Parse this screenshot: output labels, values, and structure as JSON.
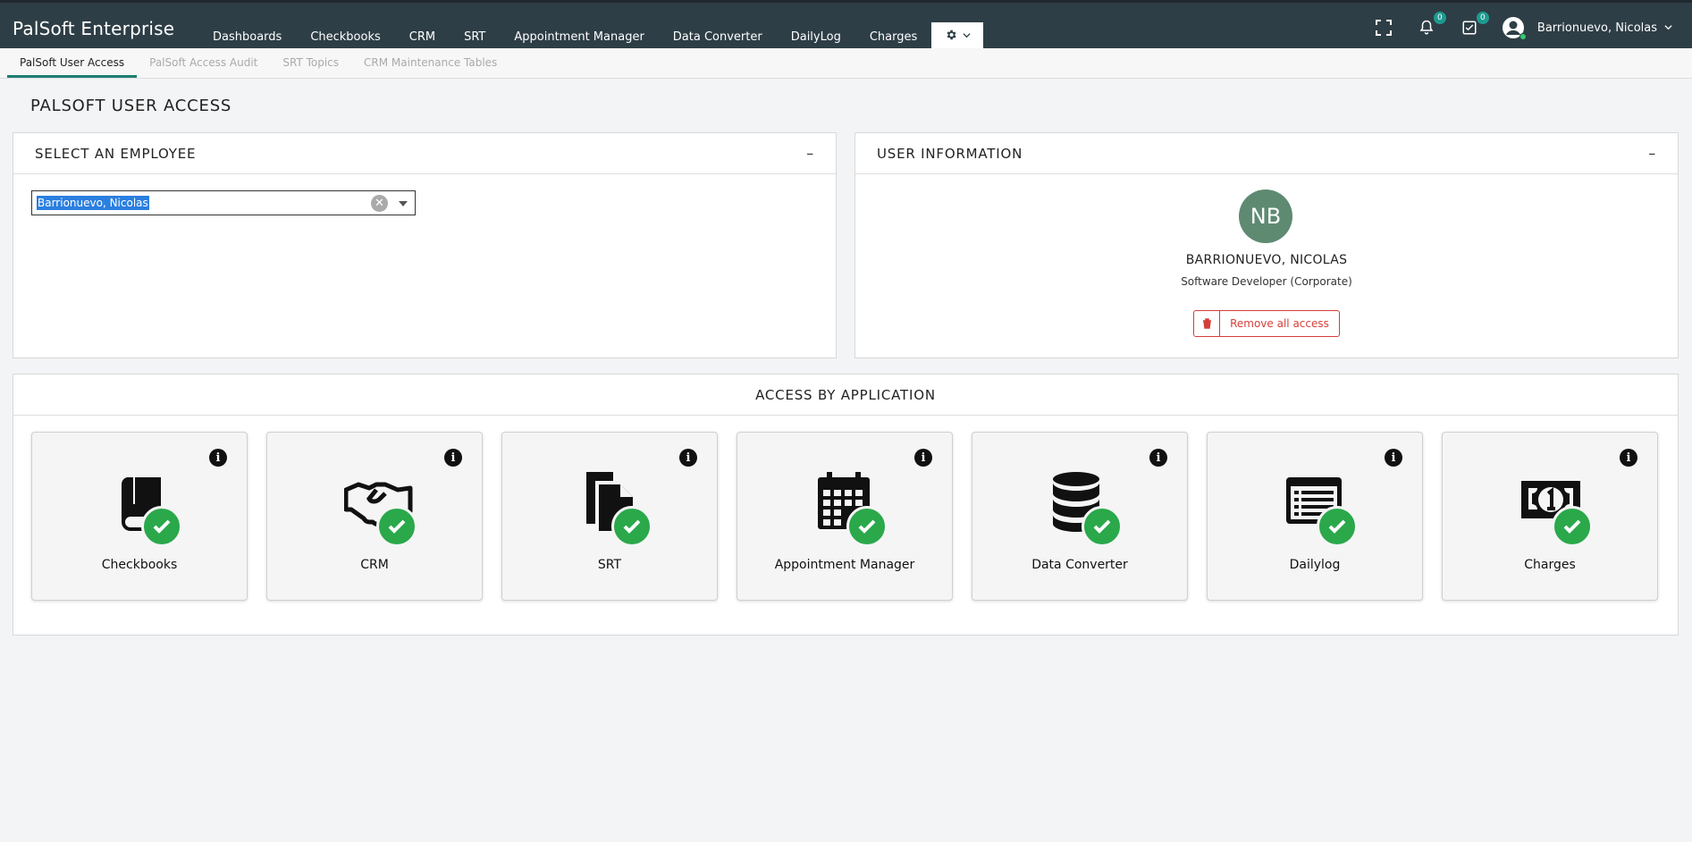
{
  "app": {
    "title": "PalSoft Enterprise"
  },
  "nav": {
    "items": [
      "Dashboards",
      "Checkbooks",
      "CRM",
      "SRT",
      "Appointment Manager",
      "Data Converter",
      "DailyLog",
      "Charges"
    ]
  },
  "topbar": {
    "notifications_count": "0",
    "tasks_count": "0",
    "user_name": "Barrionuevo, Nicolas"
  },
  "subtabs": [
    "PalSoft User Access",
    "PalSoft Access Audit",
    "SRT Topics",
    "CRM Maintenance Tables"
  ],
  "page": {
    "title": "PALSOFT USER ACCESS"
  },
  "employee_panel": {
    "title": "SELECT AN EMPLOYEE",
    "collapse": "–",
    "selected": "Barrionuevo, Nicolas"
  },
  "user_panel": {
    "title": "USER INFORMATION",
    "collapse": "–",
    "initials": "NB",
    "name": "BARRIONUEVO, NICOLAS",
    "role": "Software Developer (Corporate)",
    "remove_label": "Remove all access"
  },
  "access": {
    "title": "ACCESS BY APPLICATION",
    "apps": [
      {
        "label": "Checkbooks",
        "icon": "book-icon"
      },
      {
        "label": "CRM",
        "icon": "handshake-icon"
      },
      {
        "label": "SRT",
        "icon": "documents-icon"
      },
      {
        "label": "Appointment Manager",
        "icon": "calendar-icon"
      },
      {
        "label": "Data Converter",
        "icon": "database-icon"
      },
      {
        "label": "Dailylog",
        "icon": "list-icon"
      },
      {
        "label": "Charges",
        "icon": "money-bill-icon"
      }
    ]
  },
  "colors": {
    "topbar": "#2e3e46",
    "accent": "#1e7f72",
    "check": "#2aa84a",
    "danger": "#d43f3a",
    "avatar": "#5e8a72"
  }
}
